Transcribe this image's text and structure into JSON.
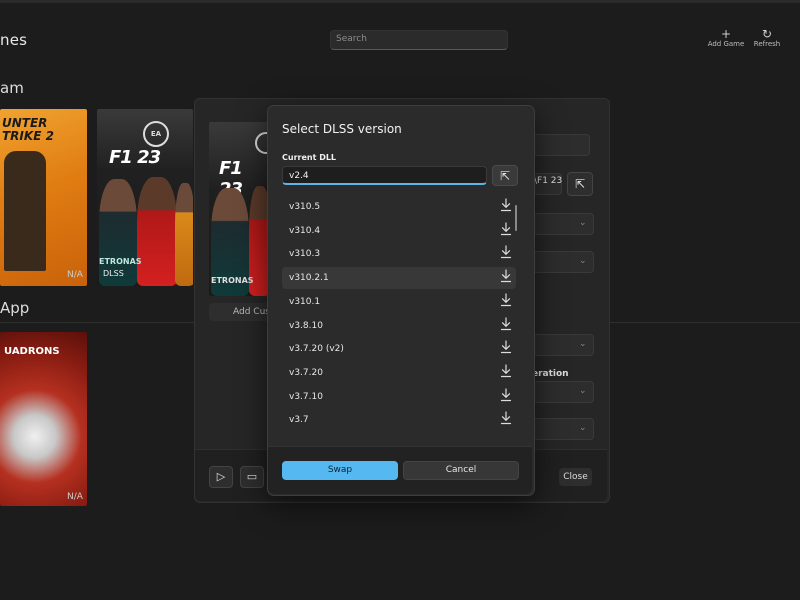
{
  "app": {
    "title": "nes",
    "search_placeholder": "Search",
    "add_game_label": "Add Game",
    "refresh_label": "Refresh"
  },
  "sections": {
    "steam": "am",
    "app": "App"
  },
  "games": {
    "cs2": {
      "title_line1": "UNTER",
      "title_line2": "TRIKE 2",
      "status": "N/A"
    },
    "f1": {
      "logo": "F1 23",
      "ea": "EA",
      "tag": "DLSS",
      "sponsor": "ETRONAS"
    },
    "squadrons": {
      "title": "UADRONS",
      "status": "N/A"
    }
  },
  "details": {
    "path_tail": "\\F1 23",
    "add_custom_label": "Add Custom",
    "frame_gen_label": "eration",
    "close_label": "Close"
  },
  "modal": {
    "title": "Select DLSS version",
    "current_label": "Current DLL",
    "current_value": "v2.4",
    "versions": [
      "v310.5",
      "v310.4",
      "v310.3",
      "v310.2.1",
      "v310.1",
      "v3.8.10",
      "v3.7.20 (v2)",
      "v3.7.20",
      "v3.7.10",
      "v3.7"
    ],
    "selected_index": 3,
    "swap_label": "Swap",
    "cancel_label": "Cancel"
  },
  "colors": {
    "accent": "#56b8f0",
    "background": "#1c1c1c",
    "modal": "#2b2b2b"
  }
}
